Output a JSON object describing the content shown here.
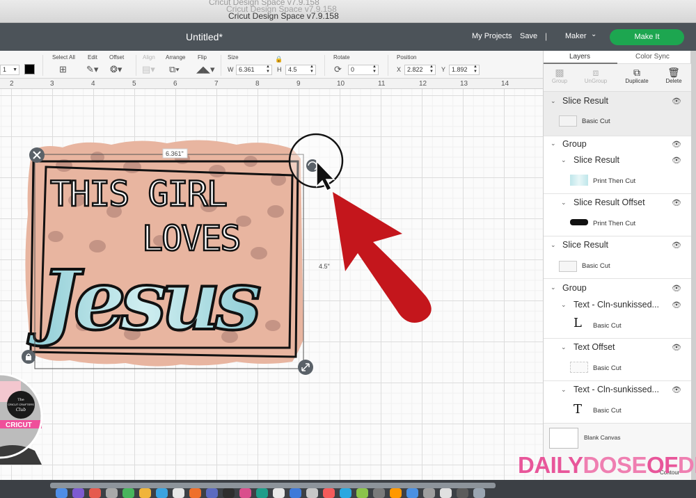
{
  "window": {
    "ghost_title_1": "Cricut Design Space  v7.9.158",
    "ghost_title_2": "Cricut Design Space  v7.9.158",
    "title": "Cricut Design Space  v7.9.158"
  },
  "header": {
    "doc_title": "Untitled*",
    "my_projects": "My Projects",
    "save": "Save",
    "separator": "|",
    "machine": "Maker",
    "make_it": "Make It"
  },
  "toolbar": {
    "line_type_value": "1",
    "select_all": "Select All",
    "edit": "Edit",
    "offset": "Offset",
    "align": "Align",
    "arrange": "Arrange",
    "flip": "Flip",
    "size": "Size",
    "w_label": "W",
    "w_value": "6.361",
    "h_label": "H",
    "h_value": "4.5",
    "rotate": "Rotate",
    "rotate_value": "0",
    "position": "Position",
    "x_label": "X",
    "x_value": "2.822",
    "y_label": "Y",
    "y_value": "1.892",
    "fill_color": "#000000"
  },
  "ruler": {
    "ticks": [
      "2",
      "3",
      "4",
      "5",
      "6",
      "7",
      "8",
      "9",
      "10",
      "11",
      "12",
      "13",
      "14"
    ]
  },
  "canvas": {
    "width_label": "6.361\"",
    "height_label": "4.5\"",
    "design_text": {
      "line1": "THIS GIRL",
      "line2": "LOVES",
      "line3": "Jesus"
    },
    "badge_text": {
      "line1": "The",
      "line2": "CRICUT CRAFTERS",
      "line3": "Club",
      "brand": "CRICUT"
    },
    "colors": {
      "design_bg": "#e8b5a0",
      "leopard": "#b98a7c",
      "script_fill": "#a9d9df",
      "arrow": "#c4161c"
    }
  },
  "panel": {
    "tabs": [
      "Layers",
      "Color Sync"
    ],
    "actions": {
      "group": "Group",
      "ungroup": "UnGroup",
      "duplicate": "Duplicate",
      "delete": "Delete"
    },
    "layers": [
      {
        "name": "Slice Result",
        "sub": "Basic Cut"
      },
      {
        "name": "Group"
      },
      {
        "name": "Slice Result",
        "sub": "Print Then Cut"
      },
      {
        "name": "Slice Result Offset",
        "sub": "Print Then Cut"
      },
      {
        "name": "Slice Result",
        "sub": "Basic Cut"
      },
      {
        "name": "Group"
      },
      {
        "name": "Text - Cln-sunkissed...",
        "sub": "Basic Cut"
      },
      {
        "name": "Text Offset",
        "sub": "Basic Cut"
      },
      {
        "name": "Text - Cln-sunkissed...",
        "sub": "Basic Cut"
      }
    ],
    "glyph_text_1": "L",
    "glyph_text_2": "T",
    "blank_canvas": "Blank Canvas",
    "contour": "Contour"
  },
  "watermark": {
    "part1": "DAILY",
    "part2": "DOSE",
    "part3": "OF",
    "part4": "DIY",
    "color1": "#e8569a",
    "color2": "#ef7fb1"
  }
}
